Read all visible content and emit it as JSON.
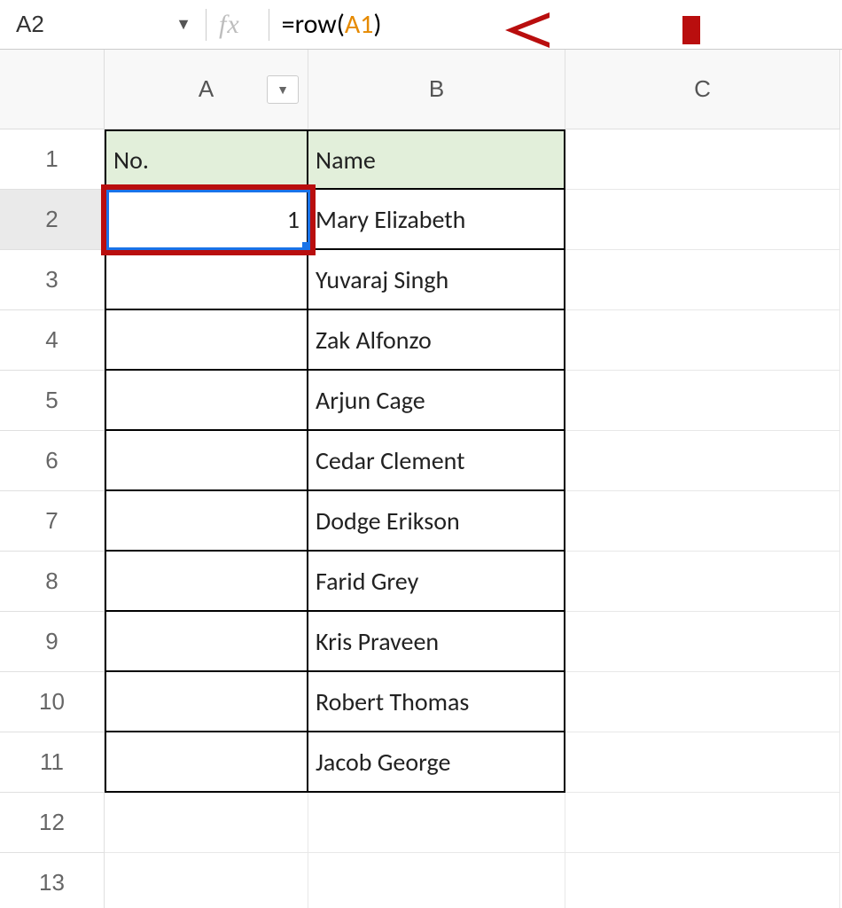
{
  "namebox": {
    "value": "A2"
  },
  "formula": {
    "prefix": "=row(",
    "ref": "A1",
    "suffix": ")"
  },
  "columns": [
    "A",
    "B",
    "C"
  ],
  "row_labels": [
    "1",
    "2",
    "3",
    "4",
    "5",
    "6",
    "7",
    "8",
    "9",
    "10",
    "11",
    "12",
    "13"
  ],
  "table": {
    "headers": {
      "a": "No.",
      "b": "Name"
    },
    "rows": [
      {
        "no": "1",
        "name": "Mary Elizabeth"
      },
      {
        "no": "",
        "name": "Yuvaraj Singh"
      },
      {
        "no": "",
        "name": "Zak Alfonzo"
      },
      {
        "no": "",
        "name": "Arjun Cage"
      },
      {
        "no": "",
        "name": "Cedar Clement"
      },
      {
        "no": "",
        "name": "Dodge Erikson"
      },
      {
        "no": "",
        "name": "Farid Grey"
      },
      {
        "no": "",
        "name": "Kris Praveen"
      },
      {
        "no": "",
        "name": "Robert Thomas"
      },
      {
        "no": "",
        "name": "Jacob George"
      }
    ]
  },
  "chart_data": {
    "type": "table",
    "columns": [
      "No.",
      "Name"
    ],
    "rows": [
      [
        "1",
        "Mary Elizabeth"
      ],
      [
        "",
        "Yuvaraj Singh"
      ],
      [
        "",
        "Zak Alfonzo"
      ],
      [
        "",
        "Arjun Cage"
      ],
      [
        "",
        "Cedar Clement"
      ],
      [
        "",
        "Dodge Erikson"
      ],
      [
        "",
        "Farid Grey"
      ],
      [
        "",
        "Kris Praveen"
      ],
      [
        "",
        "Robert Thomas"
      ],
      [
        "",
        "Jacob George"
      ]
    ]
  }
}
